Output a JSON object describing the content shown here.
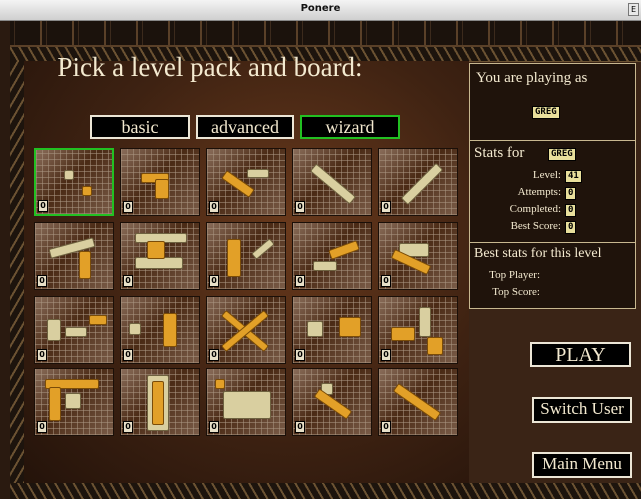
{
  "window": {
    "title": "Ponere",
    "zoom_label": "E"
  },
  "heading": "Pick a level pack and board:",
  "packs": [
    {
      "label": "basic",
      "selected": false
    },
    {
      "label": "advanced",
      "selected": false
    },
    {
      "label": "wizard",
      "selected": true
    }
  ],
  "thumbnails": [
    {
      "count": "0",
      "selected": true
    },
    {
      "count": "0",
      "selected": false
    },
    {
      "count": "0",
      "selected": false
    },
    {
      "count": "0",
      "selected": false
    },
    {
      "count": "0",
      "selected": false
    },
    {
      "count": "0",
      "selected": false
    },
    {
      "count": "0",
      "selected": false
    },
    {
      "count": "0",
      "selected": false
    },
    {
      "count": "0",
      "selected": false
    },
    {
      "count": "0",
      "selected": false
    },
    {
      "count": "0",
      "selected": false
    },
    {
      "count": "0",
      "selected": false
    },
    {
      "count": "0",
      "selected": false
    },
    {
      "count": "0",
      "selected": false
    },
    {
      "count": "0",
      "selected": false
    },
    {
      "count": "0",
      "selected": false
    },
    {
      "count": "0",
      "selected": false
    },
    {
      "count": "0",
      "selected": false
    },
    {
      "count": "0",
      "selected": false
    },
    {
      "count": "0",
      "selected": false
    }
  ],
  "sidebar": {
    "playing_as_label": "You are playing as",
    "player_name": "GREG",
    "stats_for_label": "Stats for",
    "stats_player": "GREG",
    "level_label": "Level:",
    "level_value": "41",
    "attempts_label": "Attempts:",
    "attempts_value": "0",
    "completed_label": "Completed:",
    "completed_value": "0",
    "best_score_label": "Best Score:",
    "best_score_value": "0",
    "best_stats_label": "Best stats for this level",
    "top_player_label": "Top Player:",
    "top_score_label": "Top Score:"
  },
  "buttons": {
    "play": "PLAY",
    "switch_user": "Switch User",
    "main_menu": "Main Menu"
  },
  "colors": {
    "selection_green": "#22c022",
    "piece_orange": "#e2a028",
    "badge_yellow": "#e8df9c"
  }
}
